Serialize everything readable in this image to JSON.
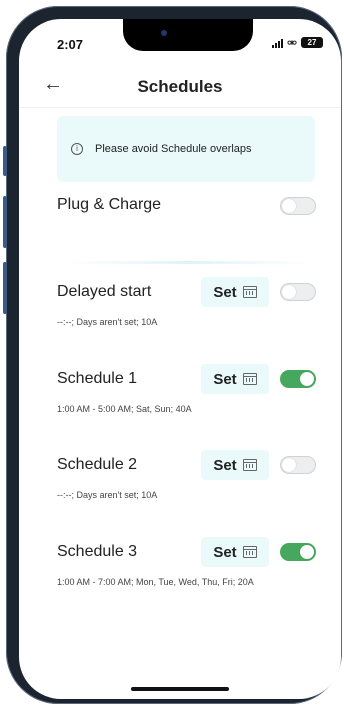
{
  "status": {
    "time": "2:07",
    "battery": "27"
  },
  "header": {
    "title": "Schedules"
  },
  "notice": {
    "text": "Please avoid Schedule overlaps",
    "icon": "info-icon"
  },
  "plug_charge": {
    "label": "Plug & Charge",
    "enabled": false
  },
  "set_label": "Set",
  "rows": [
    {
      "label": "Delayed start",
      "sub": "--:--; Days aren't set; 10A",
      "enabled": false
    },
    {
      "label": "Schedule 1",
      "sub": "1:00 AM - 5:00 AM; Sat, Sun; 40A",
      "enabled": true
    },
    {
      "label": "Schedule 2",
      "sub": "--:--; Days aren't set; 10A",
      "enabled": false
    },
    {
      "label": "Schedule 3",
      "sub": "1:00 AM - 7:00 AM; Mon, Tue, Wed, Thu, Fri; 20A",
      "enabled": true
    }
  ],
  "colors": {
    "accent": "#46a85f",
    "notice_bg": "#eafafb",
    "set_bg": "#eafafb"
  }
}
